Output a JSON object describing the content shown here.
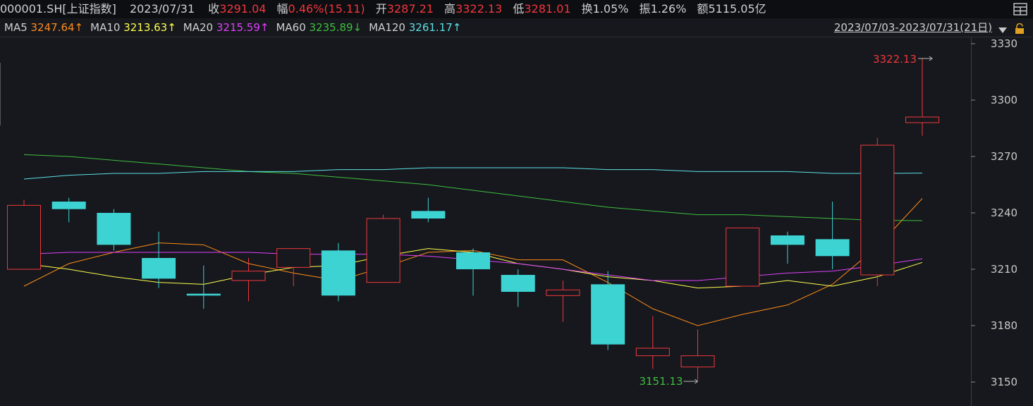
{
  "header": {
    "code": "000001.SH[上证指数]",
    "date": "2023/07/31",
    "close_label": "收",
    "close": "3291.04",
    "change_label": "幅",
    "change": "0.46%(15.11)",
    "open_label": "开",
    "open": "3287.21",
    "high_label": "高",
    "high": "3322.13",
    "low_label": "低",
    "low": "3281.01",
    "turnover_label": "换",
    "turnover": "1.05%",
    "amplitude_label": "振",
    "amplitude": "1.26%",
    "amount_label": "额",
    "amount": "5115.05亿"
  },
  "ma_bar": {
    "items": [
      {
        "label": "MA5",
        "value": "3247.64↑",
        "color": "#ff8c1a"
      },
      {
        "label": "MA10",
        "value": "3213.63↑",
        "color": "#ffff4d"
      },
      {
        "label": "MA20",
        "value": "3215.59↑",
        "color": "#e040fb"
      },
      {
        "label": "MA60",
        "value": "3235.89↓",
        "color": "#3fbf3f"
      },
      {
        "label": "MA120",
        "value": "3261.17↑",
        "color": "#5ce1e6"
      }
    ],
    "range": "2023/07/03-2023/07/31(21日)"
  },
  "colors": {
    "up": "#f0373c",
    "down": "#3dd3d3",
    "grid": "#2a2d33",
    "axis_text": "#c8c8c8"
  },
  "icons": [
    "window-icon",
    "dropdown-icon",
    "lock-icon"
  ],
  "chart_data": {
    "type": "candlestick",
    "ylim": [
      3145,
      3335
    ],
    "yticks": [
      3150,
      3180,
      3210,
      3240,
      3270,
      3300,
      3330
    ],
    "high_annotation": "3322.13",
    "low_annotation": "3151.13",
    "candles": [
      {
        "open": 3210,
        "close": 3244,
        "high": 3247,
        "low": 3210
      },
      {
        "open": 3246,
        "close": 3242,
        "high": 3248,
        "low": 3235
      },
      {
        "open": 3240,
        "close": 3223,
        "high": 3242,
        "low": 3220
      },
      {
        "open": 3216,
        "close": 3205,
        "high": 3230,
        "low": 3200
      },
      {
        "open": 3197,
        "close": 3196,
        "high": 3212,
        "low": 3189
      },
      {
        "open": 3204,
        "close": 3209,
        "high": 3216,
        "low": 3193
      },
      {
        "open": 3211,
        "close": 3221,
        "high": 3221,
        "low": 3201
      },
      {
        "open": 3220,
        "close": 3196,
        "high": 3224,
        "low": 3193
      },
      {
        "open": 3203,
        "close": 3237,
        "high": 3239,
        "low": 3203
      },
      {
        "open": 3241,
        "close": 3237,
        "high": 3248,
        "low": 3235
      },
      {
        "open": 3219,
        "close": 3210,
        "high": 3221,
        "low": 3196
      },
      {
        "open": 3207,
        "close": 3198,
        "high": 3210,
        "low": 3190
      },
      {
        "open": 3196,
        "close": 3199,
        "high": 3204,
        "low": 3182
      },
      {
        "open": 3202,
        "close": 3170,
        "high": 3209,
        "low": 3167
      },
      {
        "open": 3164,
        "close": 3168,
        "high": 3185,
        "low": 3157
      },
      {
        "open": 3158,
        "close": 3164,
        "high": 3178,
        "low": 3151.13
      },
      {
        "open": 3201,
        "close": 3232,
        "high": 3232,
        "low": 3201
      },
      {
        "open": 3228,
        "close": 3223,
        "high": 3230,
        "low": 3213
      },
      {
        "open": 3226,
        "close": 3217,
        "high": 3246,
        "low": 3210
      },
      {
        "open": 3207,
        "close": 3276,
        "high": 3280,
        "low": 3201
      },
      {
        "open": 3288,
        "close": 3291,
        "high": 3322.13,
        "low": 3281
      }
    ],
    "ma": [
      {
        "name": "MA5",
        "color": "#ff8c1a",
        "values": [
          3201,
          3213,
          3219,
          3224,
          3223,
          3213,
          3208,
          3204,
          3211,
          3219,
          3220,
          3215,
          3215,
          3203,
          3189,
          3180,
          3186,
          3191,
          3202,
          3222,
          3247.64
        ]
      },
      {
        "name": "MA10",
        "color": "#ffff4d",
        "values": [
          3213,
          3210,
          3206,
          3203,
          3202,
          3207,
          3211,
          3212,
          3217,
          3221,
          3219,
          3213,
          3210,
          3206,
          3204,
          3200,
          3201,
          3204,
          3201,
          3206,
          3213.63
        ]
      },
      {
        "name": "MA20",
        "color": "#e040fb",
        "values": [
          3218,
          3219,
          3219,
          3219,
          3219,
          3219,
          3218,
          3218,
          3218,
          3217,
          3215,
          3213,
          3210,
          3207,
          3204,
          3204,
          3206,
          3208,
          3209,
          3212,
          3215.59
        ]
      },
      {
        "name": "MA60",
        "color": "#3fbf3f",
        "values": [
          3271,
          3270,
          3268,
          3266,
          3264,
          3262,
          3261,
          3259,
          3257,
          3255,
          3252,
          3249,
          3246,
          3243,
          3241,
          3239,
          3239,
          3238,
          3237,
          3236,
          3235.89
        ]
      },
      {
        "name": "MA120",
        "color": "#5ce1e6",
        "values": [
          3258,
          3260,
          3261,
          3261,
          3262,
          3262,
          3262,
          3263,
          3263,
          3264,
          3264,
          3264,
          3264,
          3263,
          3263,
          3262,
          3262,
          3262,
          3261,
          3261,
          3261.17
        ]
      }
    ]
  }
}
